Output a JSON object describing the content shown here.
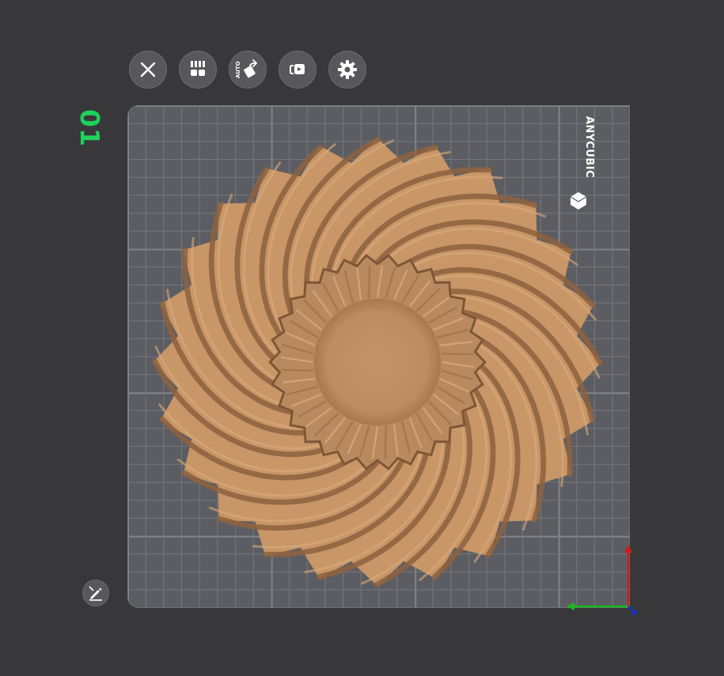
{
  "plate": {
    "number": "01",
    "brand": "ANYCUBIC"
  },
  "toolbar": {
    "buttons": [
      {
        "id": "close",
        "icon": "close-icon"
      },
      {
        "id": "arrange",
        "icon": "arrange-grid-icon"
      },
      {
        "id": "auto-orient",
        "icon": "auto-orient-icon",
        "label": "AUTO"
      },
      {
        "id": "support",
        "icon": "support-icon"
      },
      {
        "id": "settings",
        "icon": "gear-icon"
      }
    ]
  },
  "colors": {
    "background": "#38383a",
    "plate": "#5c5d62",
    "grid": "#77787c",
    "model": "#c69566",
    "plate_number": "#1ed15a",
    "axis_x": "#17b81c",
    "axis_z": "#d11a1a",
    "axis_y": "#1a2fd1"
  }
}
